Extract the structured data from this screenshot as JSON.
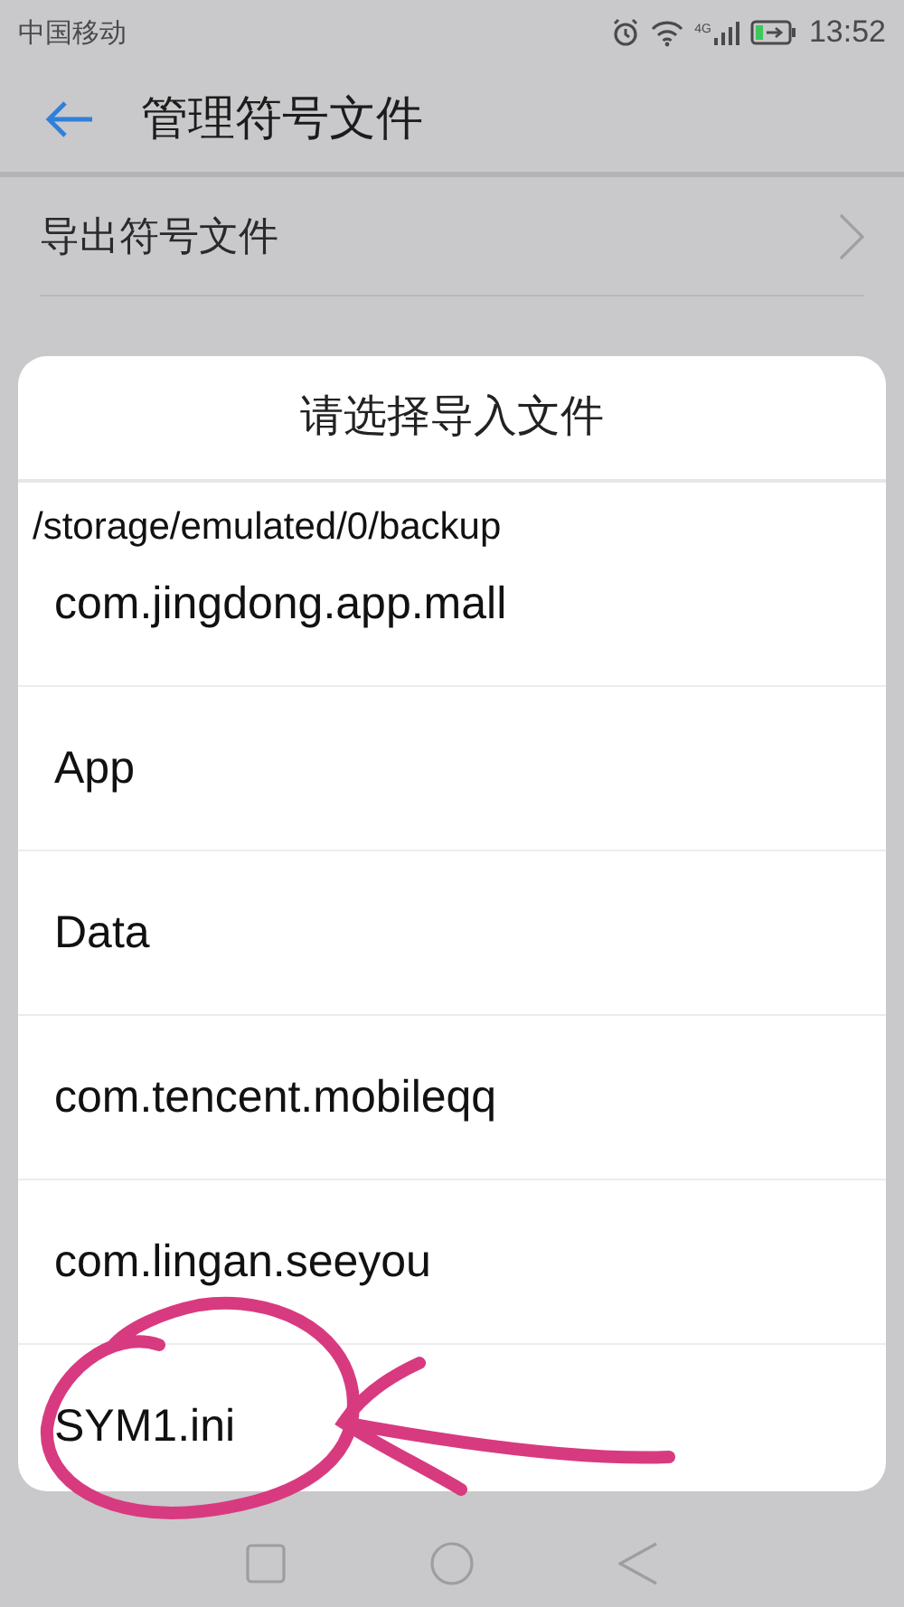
{
  "status_bar": {
    "carrier": "中国移动",
    "network": "4G",
    "time": "13:52"
  },
  "header": {
    "title": "管理符号文件"
  },
  "menu_items": [
    {
      "label": "导出符号文件"
    }
  ],
  "dialog": {
    "title": "请选择导入文件",
    "path": "/storage/emulated/0/backup",
    "items": [
      {
        "label": "com.jingdong.app.mall"
      },
      {
        "label": "App"
      },
      {
        "label": "Data"
      },
      {
        "label": "com.tencent.mobileqq"
      },
      {
        "label": "com.lingan.seeyou"
      },
      {
        "label": "SYM1.ini"
      }
    ]
  }
}
